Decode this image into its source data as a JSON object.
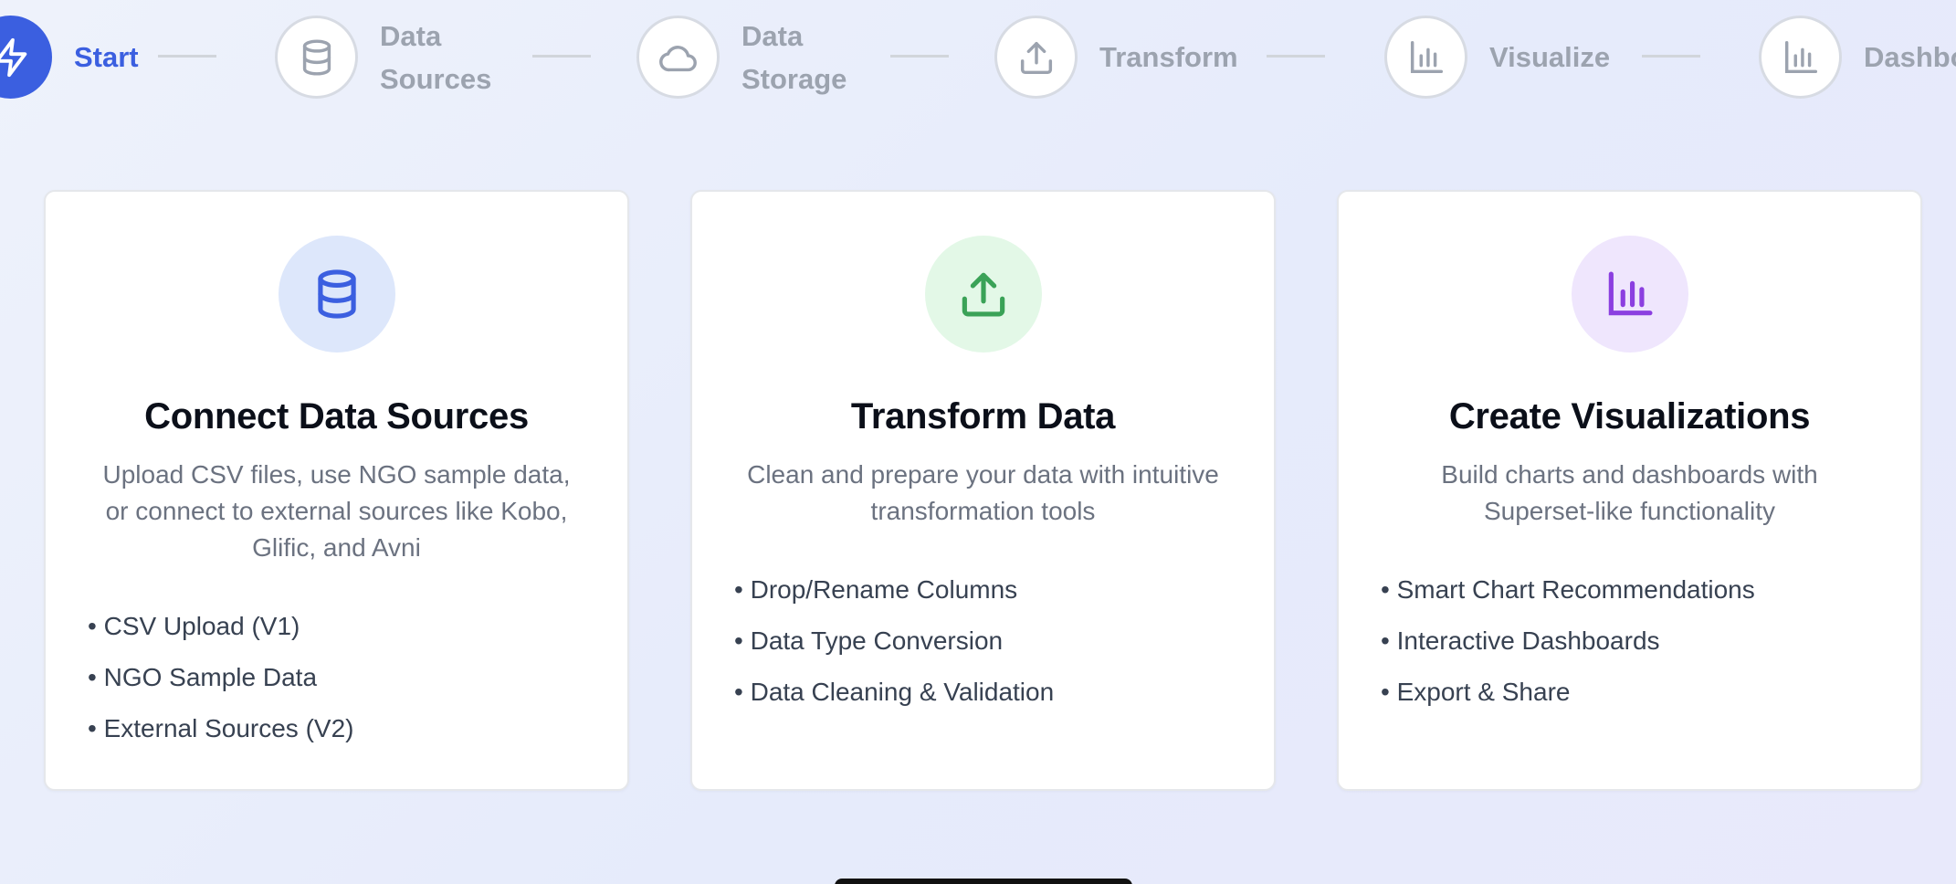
{
  "stepper": {
    "steps": [
      {
        "label": "Start",
        "icon": "zap-icon"
      },
      {
        "label": "Data\nSources",
        "icon": "database-icon"
      },
      {
        "label": "Data\nStorage",
        "icon": "cloud-icon"
      },
      {
        "label": "Transform",
        "icon": "upload-icon"
      },
      {
        "label": "Visualize",
        "icon": "bar-chart-icon"
      },
      {
        "label": "Dashbo",
        "icon": "bar-chart-icon"
      }
    ],
    "active_color": "#3b5fe0",
    "inactive_color": "#9ca3af"
  },
  "cards": [
    {
      "title": "Connect Data Sources",
      "description": "Upload CSV files, use NGO sample data, or connect to external sources like Kobo, Glific, and Avni",
      "icon": "database-icon",
      "icon_color": "#3b5fe0",
      "icon_bg": "#dde7fb",
      "items": [
        "CSV Upload (V1)",
        "NGO Sample Data",
        "External Sources (V2)"
      ]
    },
    {
      "title": "Transform Data",
      "description": "Clean and prepare your data with intuitive transformation tools",
      "icon": "upload-icon",
      "icon_color": "#3aa257",
      "icon_bg": "#e3f8e7",
      "items": [
        "Drop/Rename Columns",
        "Data Type Conversion",
        "Data Cleaning & Validation"
      ]
    },
    {
      "title": "Create Visualizations",
      "description": "Build charts and dashboards with Superset-like functionality",
      "icon": "bar-chart-icon",
      "icon_color": "#8b3fe0",
      "icon_bg": "#efe6fd",
      "items": [
        "Smart Chart Recommendations",
        "Interactive Dashboards",
        "Export & Share"
      ]
    }
  ]
}
